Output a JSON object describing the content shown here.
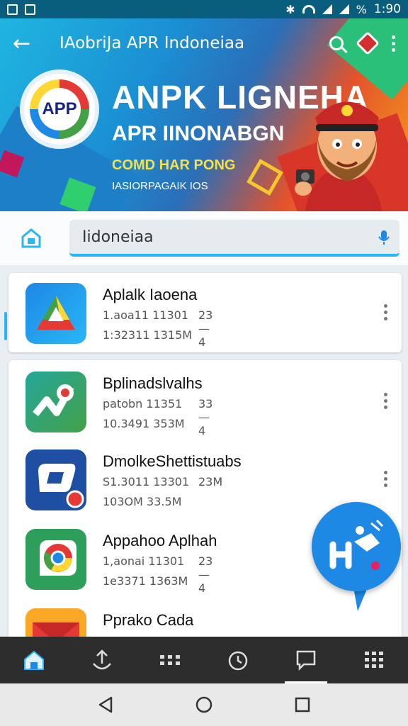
{
  "status_bar": {
    "time": "1:90"
  },
  "app_bar": {
    "title": "IAobriJa APR Indoneiaa"
  },
  "banner": {
    "logo_text": "APP",
    "headline": "ANPK LIGNEHA",
    "subheadline": "APR IINONABGN",
    "tagline": "COMD HAR PONG",
    "caption": "IASIORPAGAIK IOS"
  },
  "search": {
    "value": "Iidoneiaa"
  },
  "apps": [
    {
      "title": "Aplalk Iaoena",
      "meta1": "1.aoa11 11301",
      "meta1b": "23—4",
      "meta2": "1:32311 1315M",
      "icon": "drive-triangle-icon"
    },
    {
      "title": "Bplinadslvalhs",
      "meta1": "patobn 11351",
      "meta1b": "33—4",
      "meta2": "10.3491 353M",
      "icon": "maps-pin-icon"
    },
    {
      "title": "DmolkeShettistuabs",
      "meta1": "S1.3011 13301",
      "meta1b": "23M",
      "meta2": "103OM 33.5M",
      "icon": "chat-bubble-icon"
    },
    {
      "title": "Appahoo Aplhah",
      "meta1": "1,aonai 11301",
      "meta1b": "23—4",
      "meta2": "1e3371 1363M",
      "icon": "chrome-icon"
    },
    {
      "title": "Pprako Cada",
      "meta1": "",
      "meta1b": "",
      "meta2": "",
      "icon": "red-box-icon"
    }
  ],
  "colors": {
    "status_bar": "#0a5e7d",
    "accent": "#29b6f6",
    "fab": "#1e88e5",
    "nav_bar": "#2d2d2d"
  }
}
